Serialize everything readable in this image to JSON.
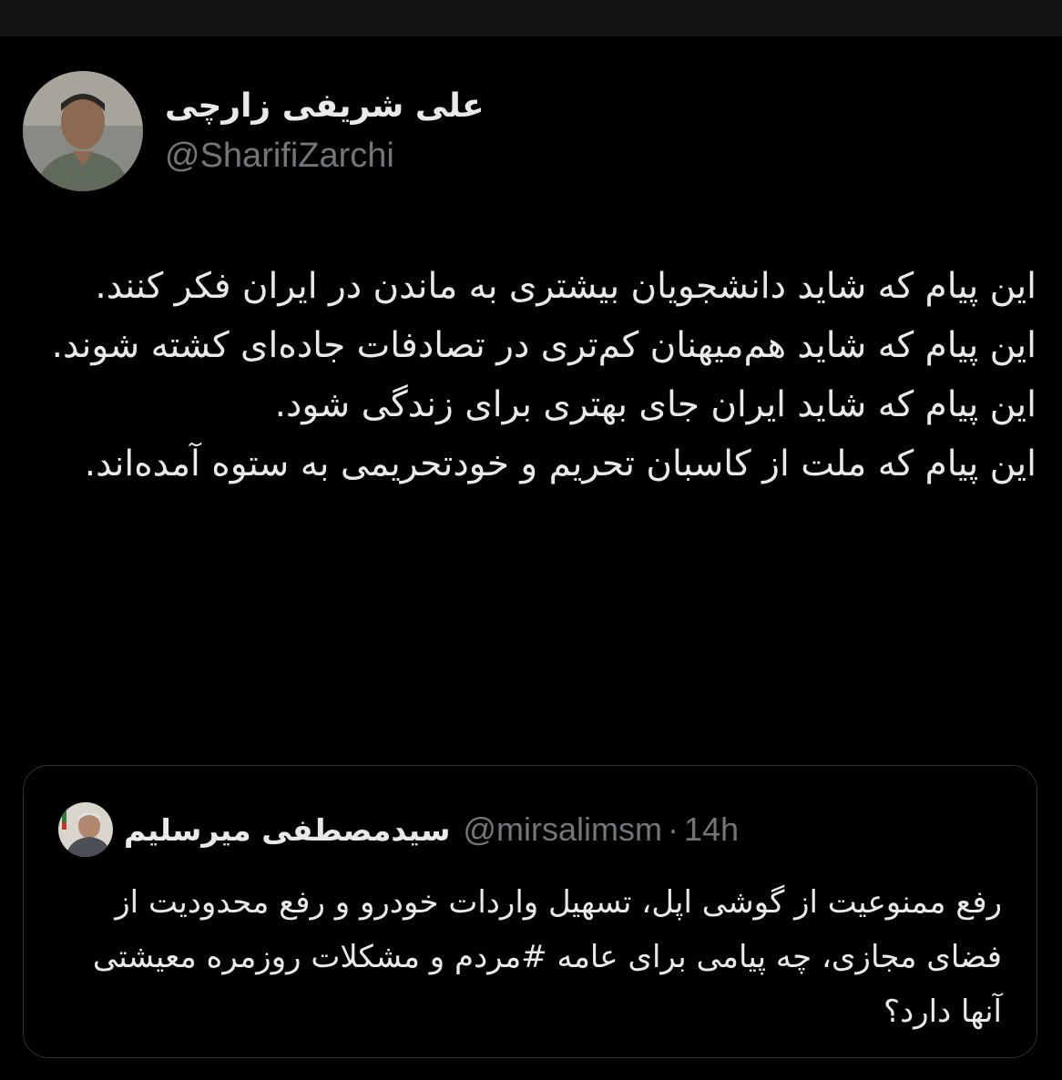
{
  "author": {
    "name": "علی شریفی زارچی",
    "handle": "@SharifiZarchi"
  },
  "tweet": {
    "lines": [
      "این پیام که شاید دانشجویان بیشتری به ماندن در ایران فکر کنند.",
      "این پیام که شاید هم‌میهنان کم‌تری در تصادفات جاده‌ای کشته شوند.",
      "این پیام که شاید ایران جای بهتری برای زندگی شود.",
      "این پیام که ملت از کاسبان تحریم و خودتحریمی به ستوه آمده‌اند."
    ]
  },
  "quoted": {
    "name": "سیدمصطفی میرسلیم",
    "handle": "@mirsalimsm",
    "separator": "·",
    "time": "14h",
    "text": "رفع ممنوعیت از گوشی اپل، تسهیل واردات خودرو و رفع محدودیت از فضای مجازی، چه پیامی برای عامه #مردم و مشکلات روزمره معیشتی آنها دارد؟"
  },
  "colors": {
    "background": "#000000",
    "text": "#e7e9ea",
    "secondary": "#71767b",
    "border": "#2f3336"
  },
  "icons": {
    "author_avatar": "profile-photo",
    "quoted_avatar": "profile-photo"
  }
}
